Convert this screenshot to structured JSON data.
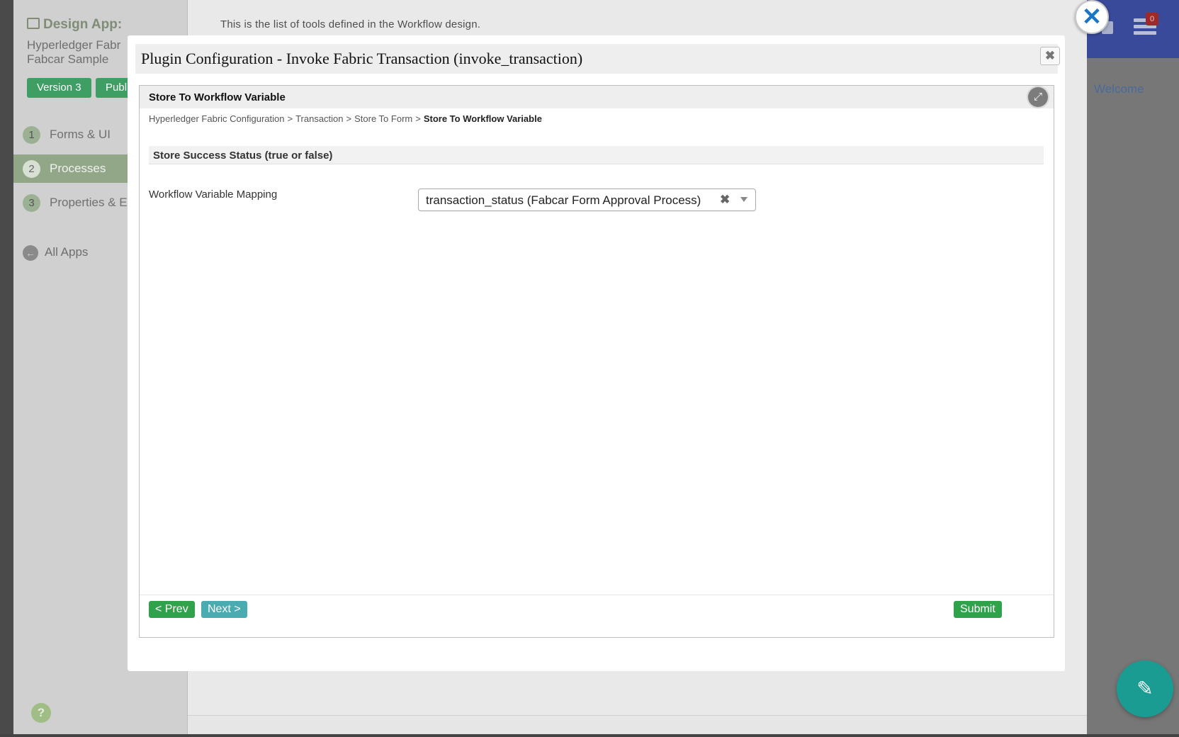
{
  "background": {
    "sidebar": {
      "title": "Design App:",
      "app_name_line1": "Hyperledger Fabr",
      "app_name_line2": "Fabcar Sample",
      "version_badge": "Version 3",
      "published_badge": "Publ",
      "items": [
        {
          "num": "1",
          "label": "Forms & UI"
        },
        {
          "num": "2",
          "label": "Processes"
        },
        {
          "num": "3",
          "label": "Properties & E"
        }
      ],
      "all_apps": "All Apps",
      "help": "?"
    },
    "intro_text": "This is the list of tools defined in the Workflow design.",
    "welcome": "Welcome",
    "nav_badge": "0"
  },
  "global_close_glyph": "✕",
  "edit_glyph": "✎",
  "modal": {
    "title": "Plugin Configuration - Invoke Fabric Transaction (invoke_transaction)",
    "close_glyph": "✖",
    "panel": {
      "title": "Store To Workflow Variable",
      "expand_glyph": "⤢",
      "breadcrumb": {
        "items": [
          "Hyperledger Fabric Configuration",
          "Transaction",
          "Store To Form"
        ],
        "separator": ">",
        "current": "Store To Workflow Variable"
      },
      "section_title": "Store Success Status (true or false)",
      "field": {
        "label": "Workflow Variable Mapping",
        "value": "transaction_status (Fabcar Form Approval Process)",
        "clear_glyph": "✖"
      },
      "buttons": {
        "prev": "< Prev",
        "next": "Next >",
        "submit": "Submit"
      }
    }
  }
}
